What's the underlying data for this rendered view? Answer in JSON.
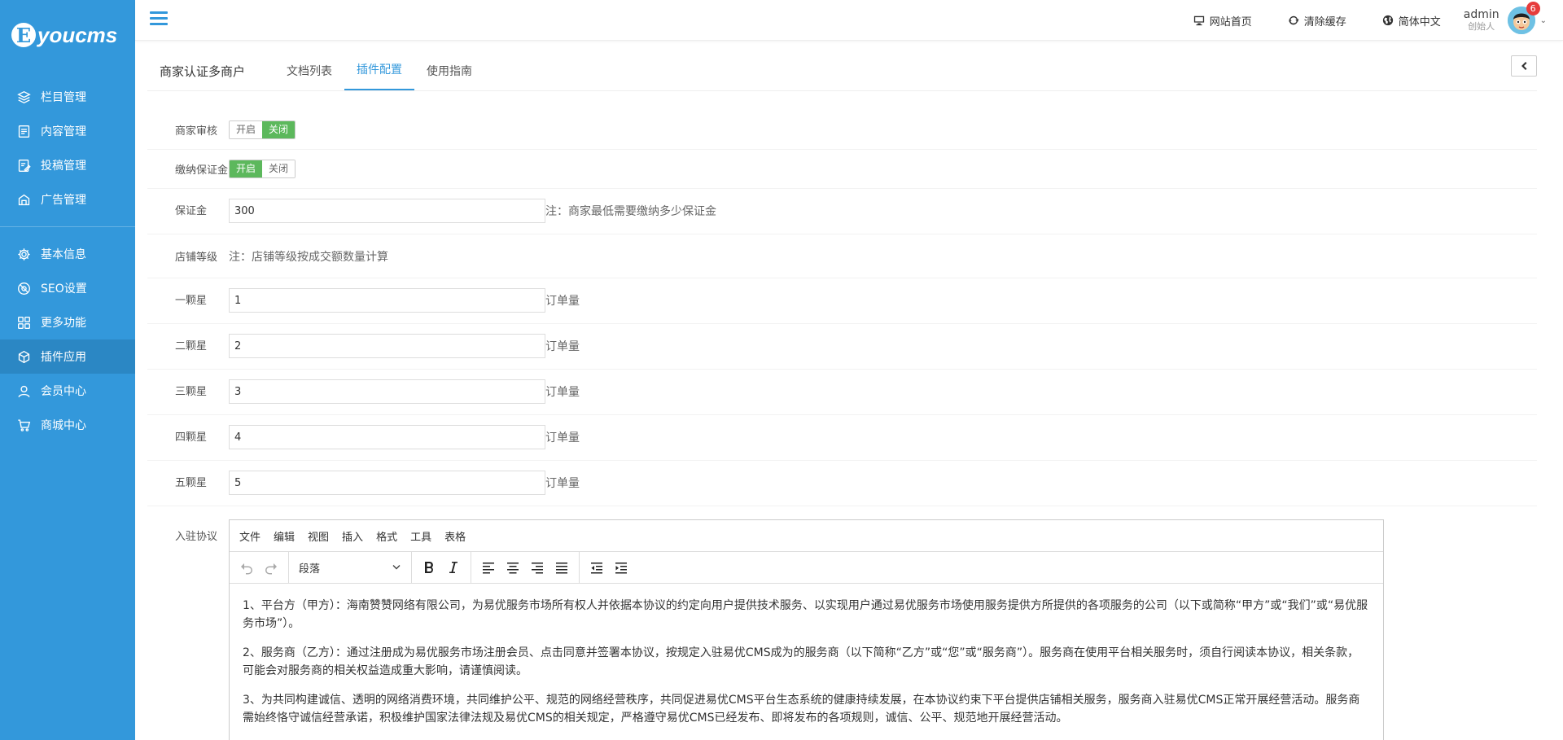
{
  "logo": {
    "letter": "E",
    "text": "youcms"
  },
  "sidebar": {
    "groups": [
      [
        {
          "label": "栏目管理",
          "icon": "layers-icon"
        },
        {
          "label": "内容管理",
          "icon": "document-icon"
        },
        {
          "label": "投稿管理",
          "icon": "edit-doc-icon"
        },
        {
          "label": "广告管理",
          "icon": "ad-icon"
        }
      ],
      [
        {
          "label": "基本信息",
          "icon": "gear-icon"
        },
        {
          "label": "SEO设置",
          "icon": "seo-icon"
        },
        {
          "label": "更多功能",
          "icon": "grid-icon"
        },
        {
          "label": "插件应用",
          "icon": "cube-icon",
          "active": true
        },
        {
          "label": "会员中心",
          "icon": "user-icon"
        },
        {
          "label": "商城中心",
          "icon": "cart-icon"
        }
      ]
    ]
  },
  "topbar": {
    "home": "网站首页",
    "clear_cache": "清除缓存",
    "language": "简体中文",
    "user_name": "admin",
    "user_role": "创始人",
    "badge_count": "6"
  },
  "page": {
    "plugin_title": "商家认证多商户",
    "tabs": [
      "文档列表",
      "插件配置",
      "使用指南"
    ],
    "active_tab": 1
  },
  "form": {
    "merchant_audit": {
      "label": "商家审核",
      "on": "开启",
      "off": "关闭",
      "value": "off"
    },
    "deposit_required": {
      "label": "缴纳保证金",
      "on": "开启",
      "off": "关闭",
      "value": "on"
    },
    "deposit": {
      "label": "保证金",
      "value": "300",
      "note": "注：商家最低需要缴纳多少保证金"
    },
    "shop_level": {
      "label": "店铺等级",
      "note": "注：店铺等级按成交额数量计算"
    },
    "stars": [
      {
        "label": "一颗星",
        "value": "1",
        "unit": "订单量"
      },
      {
        "label": "二颗星",
        "value": "2",
        "unit": "订单量"
      },
      {
        "label": "三颗星",
        "value": "3",
        "unit": "订单量"
      },
      {
        "label": "四颗星",
        "value": "4",
        "unit": "订单量"
      },
      {
        "label": "五颗星",
        "value": "5",
        "unit": "订单量"
      }
    ],
    "agreement": {
      "label": "入驻协议"
    }
  },
  "editor": {
    "menus": [
      "文件",
      "编辑",
      "视图",
      "插入",
      "格式",
      "工具",
      "表格"
    ],
    "format": "段落",
    "paragraphs": [
      "1、平台方（甲方）：海南赞赞网络有限公司，为易优服务市场所有权人并依据本协议的约定向用户提供技术服务、以实现用户通过易优服务市场使用服务提供方所提供的各项服务的公司（以下或简称“甲方”或“我们”或“易优服务市场”）。",
      "2、服务商（乙方）：通过注册成为易优服务市场注册会员、点击同意并签署本协议，按规定入驻易优CMS成为的服务商（以下简称“乙方”或“您”或“服务商”）。服务商在使用平台相关服务时，须自行阅读本协议，相关条款，可能会对服务商的相关权益造成重大影响，请谨慎阅读。",
      "3、为共同构建诚信、透明的网络消费环境，共同维护公平、规范的网络经营秩序，共同促进易优CMS平台生态系统的健康持续发展，在本协议约束下平台提供店铺相关服务，服务商入驻易优CMS正常开展经营活动。服务商需始终恪守诚信经营承诺，积极维护国家法律法规及易优CMS的相关规定，严格遵守易优CMS已经发布、即将发布的各项规则，诚信、公平、规范地开展经营活动。"
    ]
  }
}
